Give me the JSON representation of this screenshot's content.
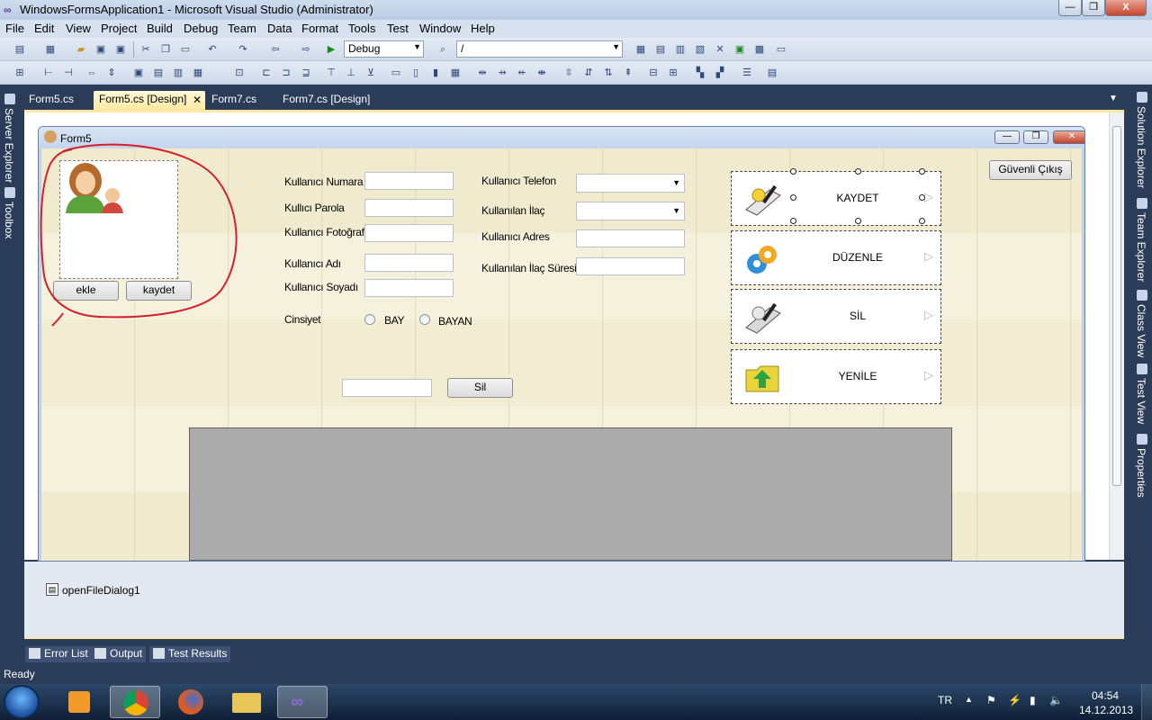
{
  "window": {
    "title": "WindowsFormsApplication1 - Microsoft Visual Studio (Administrator)",
    "minimize": "—",
    "restore": "❐",
    "close": "X"
  },
  "menu": [
    "File",
    "Edit",
    "View",
    "Project",
    "Build",
    "Debug",
    "Team",
    "Data",
    "Format",
    "Tools",
    "Test",
    "Window",
    "Help"
  ],
  "toolbar": {
    "config_combo": "Debug",
    "platform_combo": "/"
  },
  "side_left": [
    "Server Explorer",
    "Toolbox"
  ],
  "side_right": [
    "Solution Explorer",
    "Team Explorer",
    "Class View",
    "Test View",
    "Properties"
  ],
  "doc_tabs": [
    {
      "label": "Form5.cs"
    },
    {
      "label": "Form5.cs [Design]"
    },
    {
      "label": "Form7.cs"
    },
    {
      "label": "Form7.cs [Design]"
    }
  ],
  "form": {
    "title": "Form5",
    "photo_buttons": {
      "add": "ekle",
      "save": "kaydet"
    },
    "labels": {
      "user_number": "Kullanıcı Numara",
      "user_password": "Kullıcı Parola",
      "user_photo": "Kullanıcı Fotoğraf",
      "user_name": "Kullanıcı Adı",
      "user_surname": "Kullanıcı Soyadı",
      "gender": "Cinsiyet",
      "user_phone": "Kullanıcı Telefon",
      "user_medicine": "Kullanılan İlaç",
      "user_address": "Kullanıcı Adres",
      "medicine_duration": "Kullanılan İlaç Süresi"
    },
    "radio": {
      "male": "BAY",
      "female": "BAYAN"
    },
    "delete_button": "Sil",
    "secure_exit": "Güvenli Çıkış",
    "actions": [
      "KAYDET",
      "DÜZENLE",
      "SİL",
      "YENİLE"
    ]
  },
  "tray": {
    "component": "openFileDialog1"
  },
  "bottom_tabs": [
    "Error List",
    "Output",
    "Test Results"
  ],
  "status": "Ready",
  "taskbar": {
    "language": "TR",
    "time": "04:54",
    "date": "14.12.2013"
  }
}
